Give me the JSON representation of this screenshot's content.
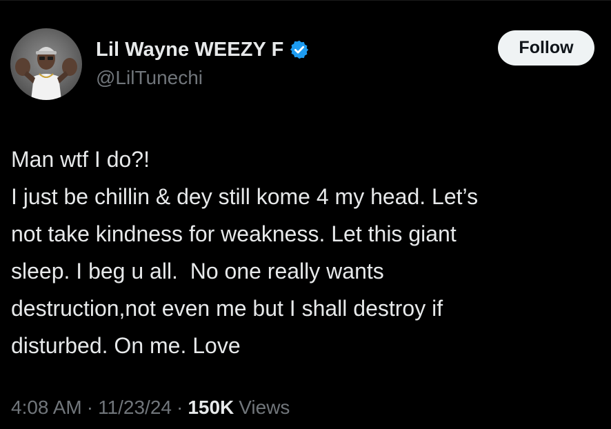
{
  "author": {
    "display_name": "Lil Wayne WEEZY F",
    "handle": "@LilTunechi",
    "verified": true,
    "verified_color": "#1d9bf0"
  },
  "follow_button": {
    "label": "Follow"
  },
  "tweet": {
    "lines": [
      "Man wtf I do?!",
      "I just be chillin & dey still kome 4 my head. Let’s",
      "not take kindness for weakness. Let this giant",
      "sleep. I beg u all.  No one really wants",
      "destruction,not even me but I shall destroy if",
      "disturbed. On me. Love"
    ]
  },
  "meta": {
    "time": "4:08 AM",
    "separator": "·",
    "date": "11/23/24",
    "views_count": "150K",
    "views_label": "Views"
  },
  "colors": {
    "background": "#000000",
    "primary_text": "#e7e9ea",
    "secondary_text": "#71767b",
    "button_bg": "#eff3f4"
  }
}
